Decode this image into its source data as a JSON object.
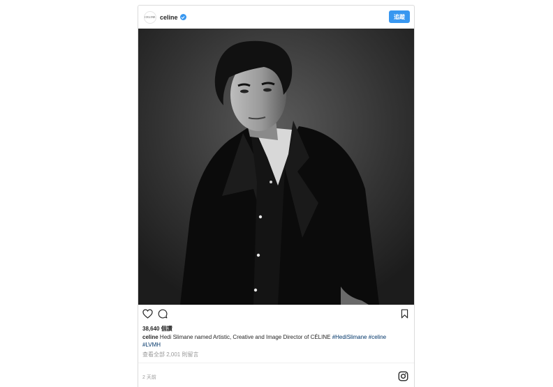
{
  "header": {
    "avatar_text": "CELINE",
    "username": "celine",
    "verified_icon": "verified-badge-icon",
    "follow_label": "追蹤"
  },
  "photo": {
    "description_icon": "portrait-photo"
  },
  "actions": {
    "like_icon": "heart-icon",
    "comment_icon": "comment-icon",
    "save_icon": "bookmark-icon"
  },
  "likes": {
    "text": "38,640 個讚"
  },
  "caption": {
    "username": "celine",
    "text": "Hedi Slimane named Artistic, Creative and Image Director of CÉLINE",
    "tags": [
      "#HediSlimane",
      "#celine",
      "#LVMH"
    ]
  },
  "comments": {
    "text": "查看全部 2,001 則留言"
  },
  "footer": {
    "time": "2 天前",
    "brand_icon": "instagram-icon"
  },
  "colors": {
    "accent": "#3897f0",
    "hashtag": "#003569",
    "muted": "#999999"
  }
}
